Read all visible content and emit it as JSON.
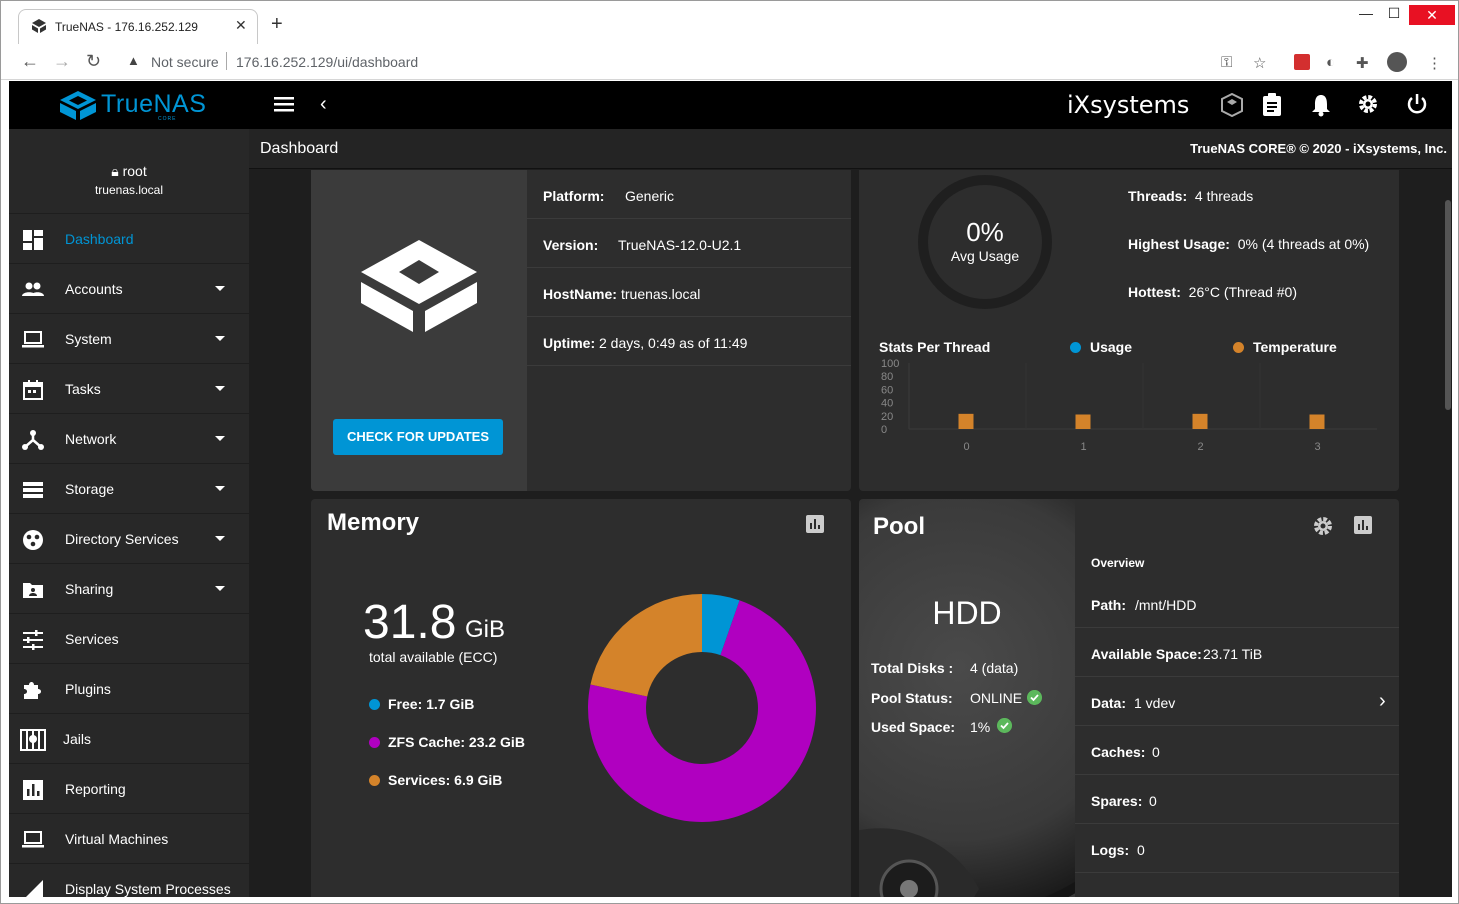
{
  "browser": {
    "tab_title": "TrueNAS - 176.16.252.129",
    "not_secure": "Not secure",
    "url": "176.16.252.129/ui/dashboard"
  },
  "app": {
    "brand": "TrueNAS",
    "brand_sub": "CORE",
    "vendor": "iXsystems",
    "page_title": "Dashboard",
    "copyright": "TrueNAS CORE® © 2020 - iXsystems, Inc.",
    "accent": "#0095d5"
  },
  "user": {
    "name": "root",
    "host": "truenas.local"
  },
  "sidebar": {
    "items": [
      {
        "label": "Dashboard",
        "icon": "dashboard-icon",
        "active": true
      },
      {
        "label": "Accounts",
        "icon": "people-icon"
      },
      {
        "label": "System",
        "icon": "laptop-icon"
      },
      {
        "label": "Tasks",
        "icon": "calendar-icon"
      },
      {
        "label": "Network",
        "icon": "network-icon"
      },
      {
        "label": "Storage",
        "icon": "storage-icon"
      },
      {
        "label": "Directory Services",
        "icon": "directory-icon"
      },
      {
        "label": "Sharing",
        "icon": "folder-share-icon"
      },
      {
        "label": "Services",
        "icon": "tune-icon"
      },
      {
        "label": "Plugins",
        "icon": "puzzle-icon"
      },
      {
        "label": "Jails",
        "icon": "jail-icon"
      },
      {
        "label": "Reporting",
        "icon": "bar-chart-icon"
      },
      {
        "label": "Virtual Machines",
        "icon": "monitor-icon"
      },
      {
        "label": "Display System Processes",
        "icon": "processes-icon"
      }
    ]
  },
  "system": {
    "platform_label": "Platform:",
    "platform": "Generic",
    "version_label": "Version:",
    "version": "TrueNAS-12.0-U2.1",
    "hostname_label": "HostName:",
    "hostname": "truenas.local",
    "uptime_label": "Uptime:",
    "uptime": "2 days, 0:49 as of 11:49",
    "check_updates": "CHECK FOR UPDATES"
  },
  "cpu": {
    "avg_value": "0%",
    "avg_label": "Avg Usage",
    "threads_label": "Threads:",
    "threads": "4 threads",
    "highest_label": "Highest Usage:",
    "highest": "0%  (4 threads at 0%)",
    "hottest_label": "Hottest:",
    "hottest": "26°C  (Thread #0)",
    "chart_title": "Stats Per Thread",
    "legend_usage": "Usage",
    "legend_temp": "Temperature",
    "usage_color": "#0095d5",
    "temp_color": "#d4832a"
  },
  "chart_data": {
    "type": "bar",
    "title": "Stats Per Thread",
    "categories": [
      "0",
      "1",
      "2",
      "3"
    ],
    "y_ticks": [
      "100",
      "80",
      "60",
      "40",
      "20",
      "0"
    ],
    "ylim": [
      0,
      100
    ],
    "series": [
      {
        "name": "Usage",
        "values": [
          0,
          0,
          0,
          0
        ]
      },
      {
        "name": "Temperature",
        "values": [
          26,
          25,
          26,
          25
        ]
      }
    ]
  },
  "memory": {
    "title": "Memory",
    "total_value": "31.8",
    "total_unit": "GiB",
    "total_label": "total available (ECC)",
    "legend": [
      {
        "label": "Free: 1.7 GiB",
        "color": "#0095d5",
        "value": 1.7
      },
      {
        "label": "ZFS Cache: 23.2 GiB",
        "color": "#b000c0",
        "value": 23.2
      },
      {
        "label": "Services: 6.9 GiB",
        "color": "#d4832a",
        "value": 6.9
      }
    ]
  },
  "pool": {
    "title": "Pool",
    "name": "HDD",
    "total_disks_label": "Total Disks :",
    "total_disks": "4 (data)",
    "status_label": "Pool Status:",
    "status": "ONLINE",
    "used_label": "Used Space:",
    "used": "1%",
    "overview": "Overview",
    "path_label": "Path:",
    "path": "/mnt/HDD",
    "avail_label": "Available Space:",
    "avail": "23.71  TiB",
    "data_label": "Data:",
    "data": "1 vdev",
    "caches_label": "Caches:",
    "caches": "0",
    "spares_label": "Spares:",
    "spares": "0",
    "logs_label": "Logs:",
    "logs": "0"
  }
}
